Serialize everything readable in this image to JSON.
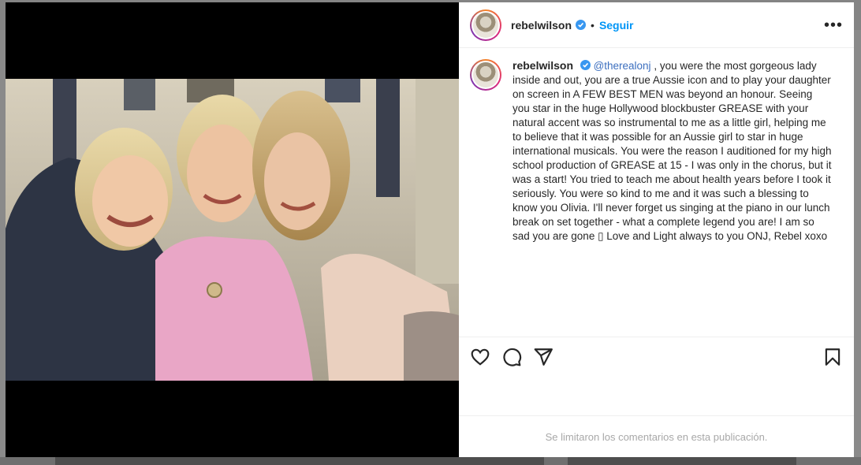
{
  "post": {
    "username": "rebelwilson",
    "follow_label": "Seguir",
    "dot": "•",
    "more_label": "•••",
    "caption_mention": "@therealonj",
    "caption_text": " , you were the most gorgeous lady inside and out, you are a true Aussie icon and to play your daughter on screen in A FEW BEST MEN was beyond an honour. Seeing you star in the huge Hollywood blockbuster GREASE with your natural accent was so instrumental to me as a little girl, helping me to believe that it was possible for an Aussie girl to star in huge international musicals. You were the reason I auditioned for my high school production of GREASE at 15 - I was only in the chorus, but it was a start! You tried to teach me about health years before I took it seriously. You were so kind to me and it was such a blessing to know you Olivia. I'll never forget us singing at the piano in our lunch break on set together - what a complete legend you are! I am so sad you are gone ▯ Love and Light always to you ONJ, Rebel xoxo",
    "comments_disabled_text": "Se limitaron los comentarios en esta publicación."
  },
  "icons": {
    "verified": "verified-badge-icon",
    "like": "heart-icon",
    "comment": "comment-bubble-icon",
    "share": "paper-plane-icon",
    "save": "bookmark-icon",
    "more": "more-options-icon"
  },
  "colors": {
    "follow": "#0095f6",
    "verified": "#3897f0",
    "text": "#262626",
    "muted": "#a8a8a8"
  }
}
